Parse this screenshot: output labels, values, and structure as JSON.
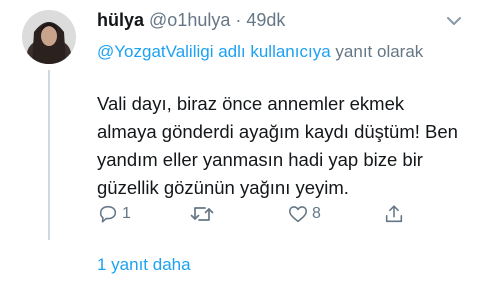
{
  "tweet": {
    "name": "hülya",
    "handle": "@o1hulya",
    "time": "· 49dk",
    "reply_to_mention": "@YozgatValiligi adlı kullanıcıya",
    "reply_to_suffix": "yanıt olarak",
    "text": "Vali dayı, biraz önce annemler ekmek almaya gönderdi ayağım kaydı düştüm! Ben yandım eller yanmasın hadi yap bize bir güzellik gözünün yağını yeyim.",
    "reply_count": "1",
    "retweet_count": "",
    "like_count": "8"
  },
  "thread": {
    "more_replies_label": "1 yanıt daha"
  },
  "colors": {
    "accent": "#1da1f2",
    "secondary_text": "#657786",
    "primary_text": "#14171a",
    "thread_line": "#cfd9de"
  },
  "icons": {
    "reply": "reply-icon",
    "retweet": "retweet-icon",
    "like": "heart-icon",
    "share": "share-icon",
    "menu": "chevron-down-icon"
  }
}
